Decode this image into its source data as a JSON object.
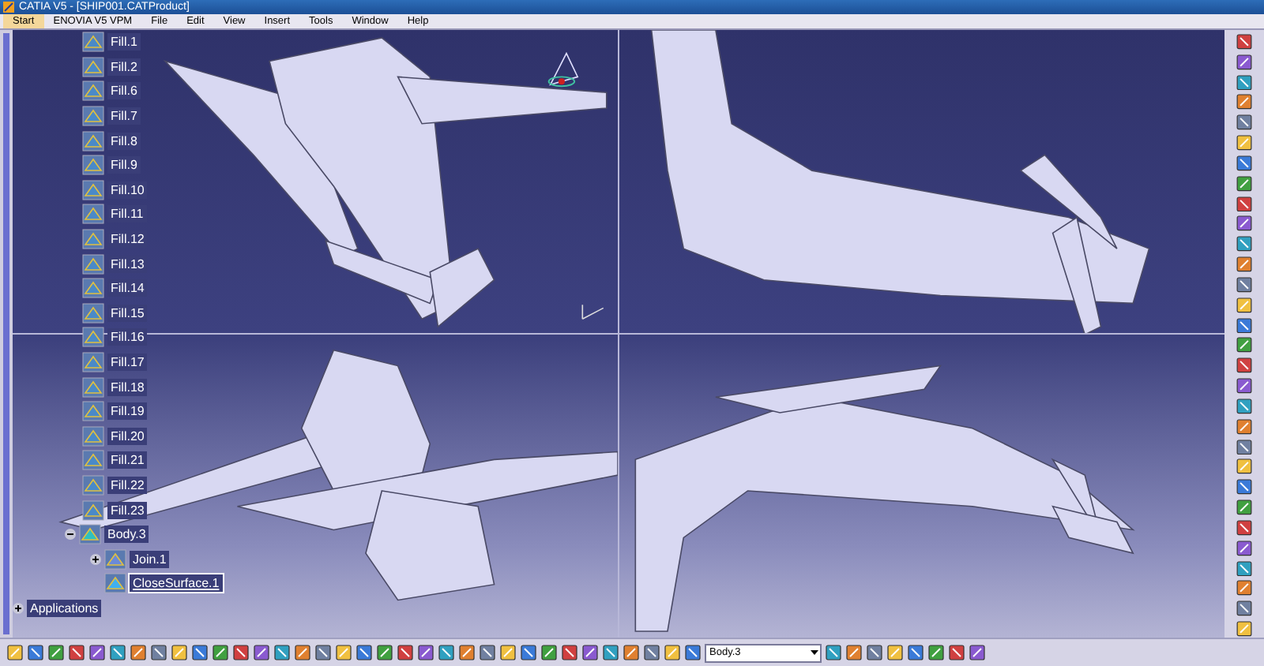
{
  "window": {
    "title": "CATIA V5 - [SHIP001.CATProduct]"
  },
  "menu": [
    {
      "label": "Start",
      "selected": true
    },
    {
      "label": "ENOVIA V5 VPM",
      "selected": false
    },
    {
      "label": "File",
      "selected": false
    },
    {
      "label": "Edit",
      "selected": false
    },
    {
      "label": "View",
      "selected": false
    },
    {
      "label": "Insert",
      "selected": false
    },
    {
      "label": "Tools",
      "selected": false
    },
    {
      "label": "Window",
      "selected": false
    },
    {
      "label": "Help",
      "selected": false
    }
  ],
  "tree": {
    "items": [
      {
        "label": "Fill.1",
        "kind": "fill",
        "selected": false
      },
      {
        "label": "Fill.2",
        "kind": "fill",
        "selected": false
      },
      {
        "label": "Fill.6",
        "kind": "fill",
        "selected": false
      },
      {
        "label": "Fill.7",
        "kind": "fill",
        "selected": false
      },
      {
        "label": "Fill.8",
        "kind": "fill",
        "selected": false
      },
      {
        "label": "Fill.9",
        "kind": "fill",
        "selected": false
      },
      {
        "label": "Fill.10",
        "kind": "fill",
        "selected": false
      },
      {
        "label": "Fill.11",
        "kind": "fill",
        "selected": false
      },
      {
        "label": "Fill.12",
        "kind": "fill",
        "selected": false
      },
      {
        "label": "Fill.13",
        "kind": "fill",
        "selected": false
      },
      {
        "label": "Fill.14",
        "kind": "fill",
        "selected": false
      },
      {
        "label": "Fill.15",
        "kind": "fill",
        "selected": false
      },
      {
        "label": "Fill.16",
        "kind": "fill",
        "selected": false
      },
      {
        "label": "Fill.17",
        "kind": "fill",
        "selected": false
      },
      {
        "label": "Fill.18",
        "kind": "fill",
        "selected": false
      },
      {
        "label": "Fill.19",
        "kind": "fill",
        "selected": false
      },
      {
        "label": "Fill.20",
        "kind": "fill",
        "selected": false
      },
      {
        "label": "Fill.21",
        "kind": "fill",
        "selected": false
      },
      {
        "label": "Fill.22",
        "kind": "fill",
        "selected": false
      },
      {
        "label": "Fill.23",
        "kind": "fill",
        "selected": false
      },
      {
        "label": "Body.3",
        "kind": "body",
        "selected": false,
        "expanded": true,
        "children": [
          {
            "label": "Join.1",
            "kind": "join",
            "selected": false,
            "expanded": false
          },
          {
            "label": "CloseSurface.1",
            "kind": "surface",
            "selected": true
          }
        ]
      }
    ],
    "applications": {
      "label": "Applications",
      "expanded": false
    }
  },
  "toolbar": {
    "body_select": {
      "value": "Body.3"
    }
  }
}
